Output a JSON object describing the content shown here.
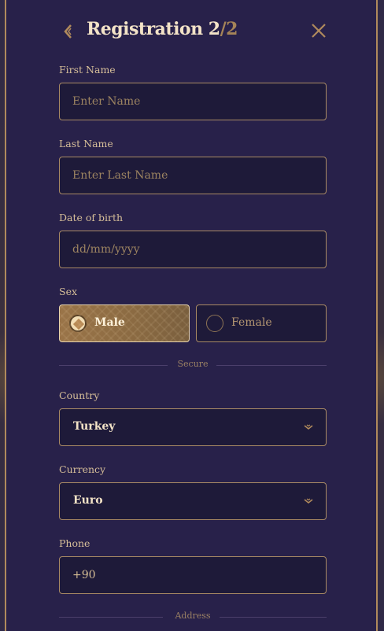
{
  "header": {
    "title": "Registration ",
    "step_current": "2",
    "step_separator": "/",
    "step_total": "2"
  },
  "fields": {
    "first_name": {
      "label": "First Name",
      "placeholder": "Enter Name",
      "value": ""
    },
    "last_name": {
      "label": "Last Name",
      "placeholder": "Enter Last Name",
      "value": ""
    },
    "dob": {
      "label": "Date of birth",
      "placeholder": "dd/mm/yyyy",
      "value": ""
    },
    "sex": {
      "label": "Sex",
      "options": [
        {
          "label": "Male",
          "selected": true
        },
        {
          "label": "Female",
          "selected": false
        }
      ]
    },
    "secure_divider": "Secure",
    "country": {
      "label": "Country",
      "value": "Turkey"
    },
    "currency": {
      "label": "Currency",
      "value": "Euro"
    },
    "phone": {
      "label": "Phone",
      "value": "+90"
    },
    "address_divider": "Address"
  },
  "colors": {
    "panel_bg": "#28214a",
    "accent_gold": "#b08a5c",
    "text_light": "#f3e3c7",
    "field_bg": "#1e1a39"
  }
}
